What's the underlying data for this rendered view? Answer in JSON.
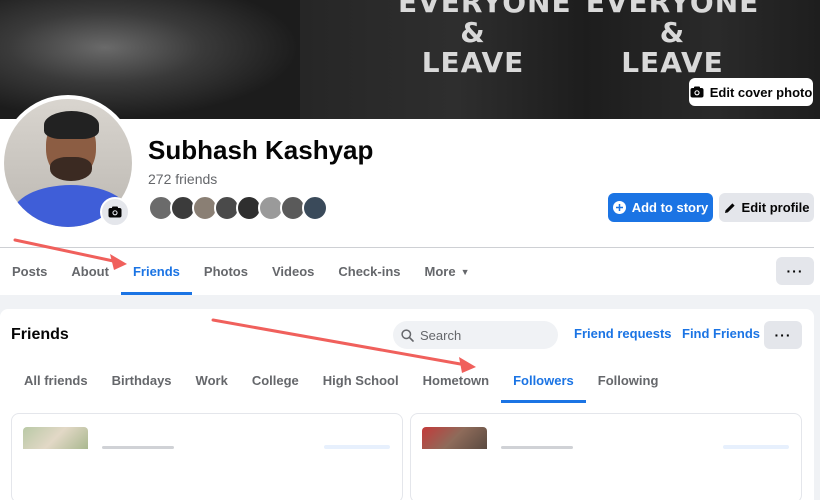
{
  "cover": {
    "shirt_left": [
      "EVERYONE",
      "&",
      "LEAVE"
    ],
    "shirt_right": [
      "EVERYONE",
      "&",
      "LEAVE"
    ],
    "edit_cover_label": "Edit cover photo"
  },
  "profile": {
    "name": "Subhash Kashyap",
    "friend_count": "272 friends",
    "mutual_colors": [
      "#6b6b6b",
      "#3b3b3b",
      "#8a7f74",
      "#4a4a4a",
      "#2f2f2f",
      "#9a9a9a",
      "#5a5a5a",
      "#3a4a5a"
    ],
    "add_story_label": "Add to story",
    "edit_profile_label": "Edit profile"
  },
  "profile_tabs": [
    "Posts",
    "About",
    "Friends",
    "Photos",
    "Videos",
    "Check-ins",
    "More"
  ],
  "friends_section": {
    "title": "Friends",
    "search_placeholder": "Search",
    "friend_requests_label": "Friend requests",
    "find_friends_label": "Find Friends",
    "tabs": [
      "All friends",
      "Birthdays",
      "Work",
      "College",
      "High School",
      "Hometown",
      "Followers",
      "Following"
    ]
  },
  "icons": {
    "more": "···"
  },
  "colors": {
    "accent": "#1b74e4",
    "arrow": "#f0605c"
  }
}
